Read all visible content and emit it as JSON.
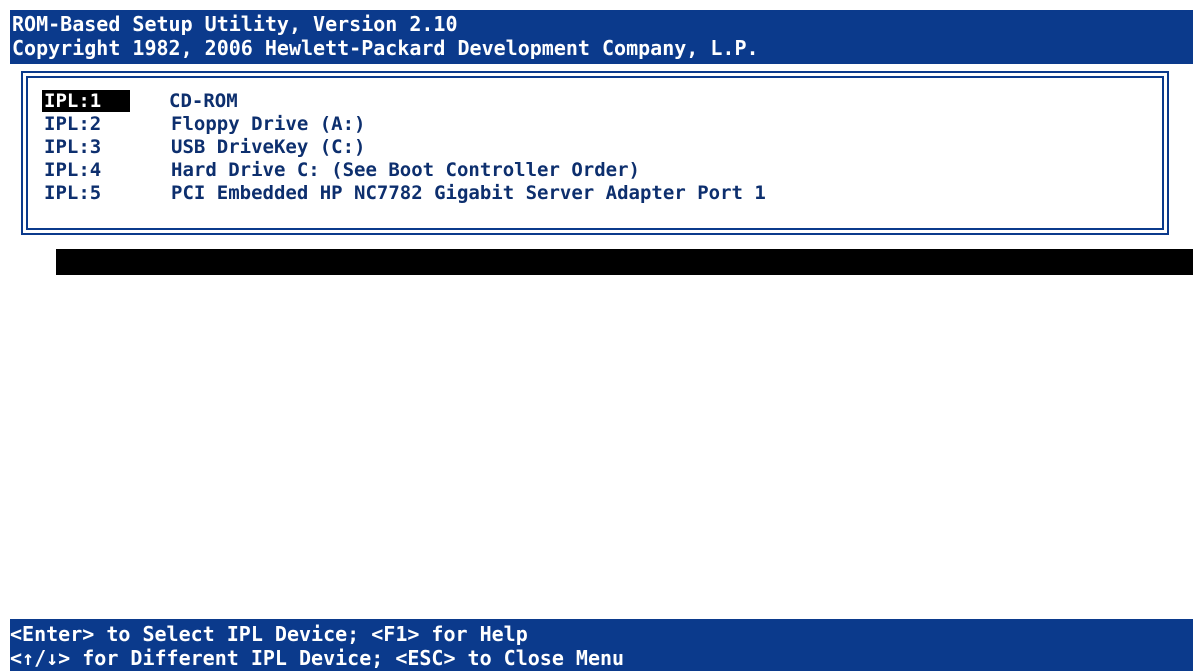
{
  "header": {
    "line1": "ROM-Based Setup Utility, Version 2.10",
    "line2": "Copyright 1982, 2006 Hewlett-Packard Development Company, L.P."
  },
  "ipl_menu": {
    "selected_index": 0,
    "items": [
      {
        "id": "IPL:1",
        "device": "CD-ROM"
      },
      {
        "id": "IPL:2",
        "device": "Floppy Drive (A:)"
      },
      {
        "id": "IPL:3",
        "device": "USB DriveKey (C:)"
      },
      {
        "id": "IPL:4",
        "device": "Hard Drive C: (See Boot Controller Order)"
      },
      {
        "id": "IPL:5",
        "device": "PCI Embedded HP NC7782 Gigabit Server Adapter Port 1"
      }
    ]
  },
  "footer": {
    "line1": "<Enter> to Select IPL Device; <F1> for Help",
    "line2": "<↑/↓> for Different IPL Device; <ESC> to Close Menu"
  },
  "colors": {
    "bar_background": "#0b3a8c",
    "bar_text": "#ffffff",
    "menu_text": "#0d2f6e",
    "selection_background": "#000000",
    "selection_text": "#ffffff",
    "screen_background": "#ffffff"
  }
}
